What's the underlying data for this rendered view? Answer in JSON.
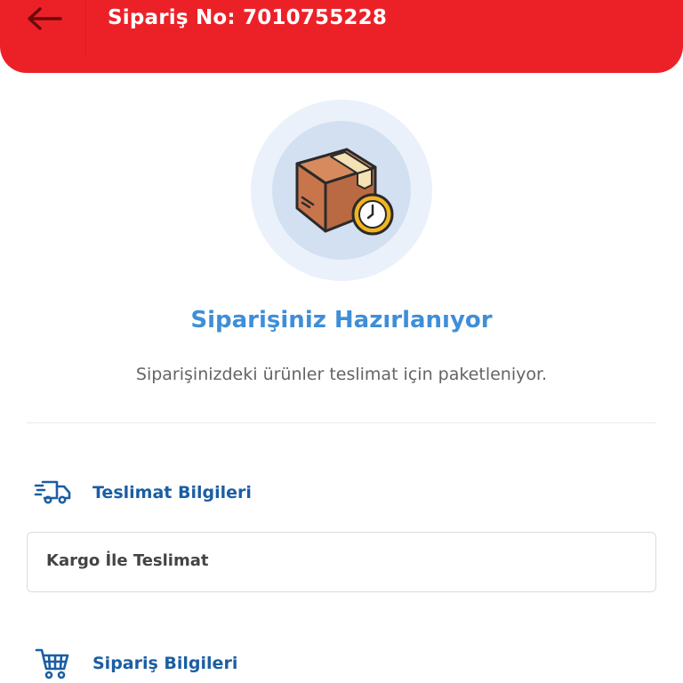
{
  "header": {
    "title": "Sipariş No: 7010755228",
    "back_icon": "arrow-left-icon",
    "color": "#ec2128"
  },
  "status": {
    "icon": "package-clock-icon",
    "title": "Siparişiniz Hazırlanıyor",
    "description": "Siparişinizdeki ürünler teslimat için paketleniyor.",
    "title_color": "#3f8ed8"
  },
  "sections": {
    "delivery": {
      "icon": "delivery-truck-icon",
      "label": "Teslimat Bilgileri",
      "method": "Kargo İle Teslimat"
    },
    "order": {
      "icon": "shopping-cart-icon",
      "label": "Sipariş Bilgileri"
    }
  },
  "accent_color": "#1b5ea3"
}
